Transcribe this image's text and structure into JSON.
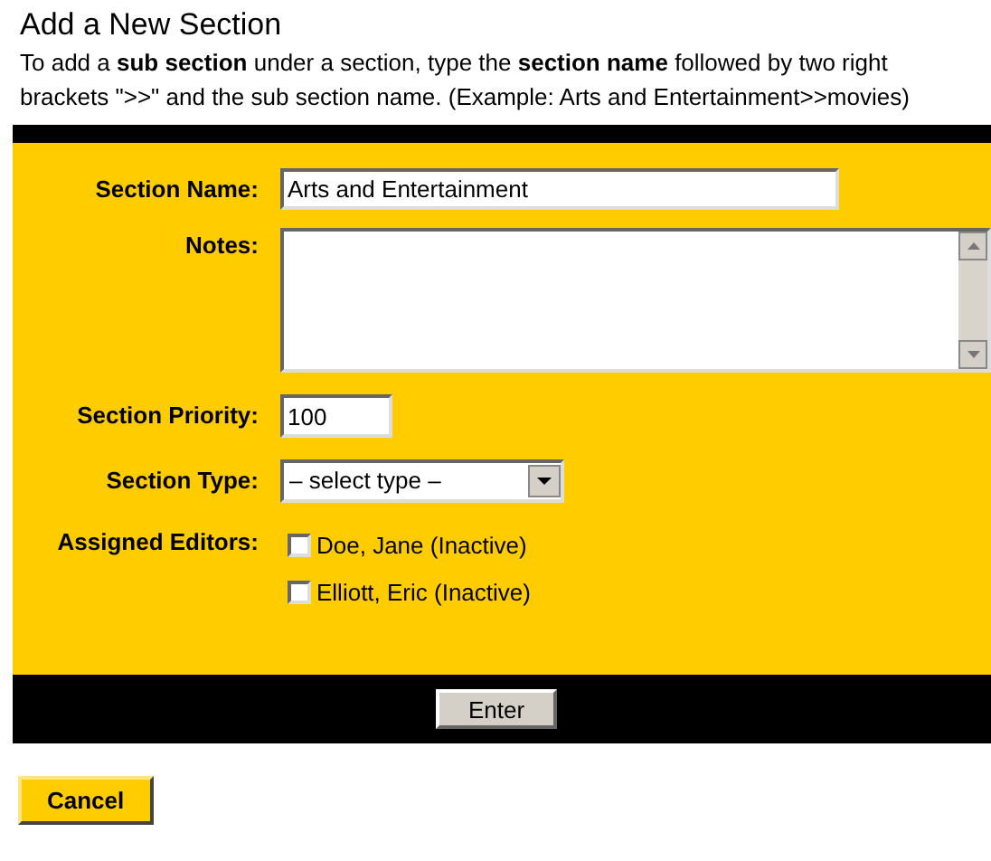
{
  "heading": "Add a New Section",
  "instructions": "To add a **sub section** under a section, type the **section name** followed by two right brackets \">>\" and the sub section name. (Example: Arts and Entertainment>>movies)",
  "form": {
    "section_name": {
      "label": "Section Name:",
      "value": "Arts and Entertainment"
    },
    "notes": {
      "label": "Notes:"
    },
    "section_priority": {
      "label": "Section Priority:",
      "value": "100"
    },
    "section_type": {
      "label": "Section Type:",
      "value": "– select type –"
    },
    "assigned_editors": {
      "label": "Assigned Editors:",
      "editors": [
        {
          "name": "Doe, Jane (Inactive)",
          "checked": false
        },
        {
          "name": "Elliott, Eric (Inactive)",
          "checked": false
        }
      ]
    }
  },
  "enter_button": "Enter",
  "cancel_button": "Cancel"
}
